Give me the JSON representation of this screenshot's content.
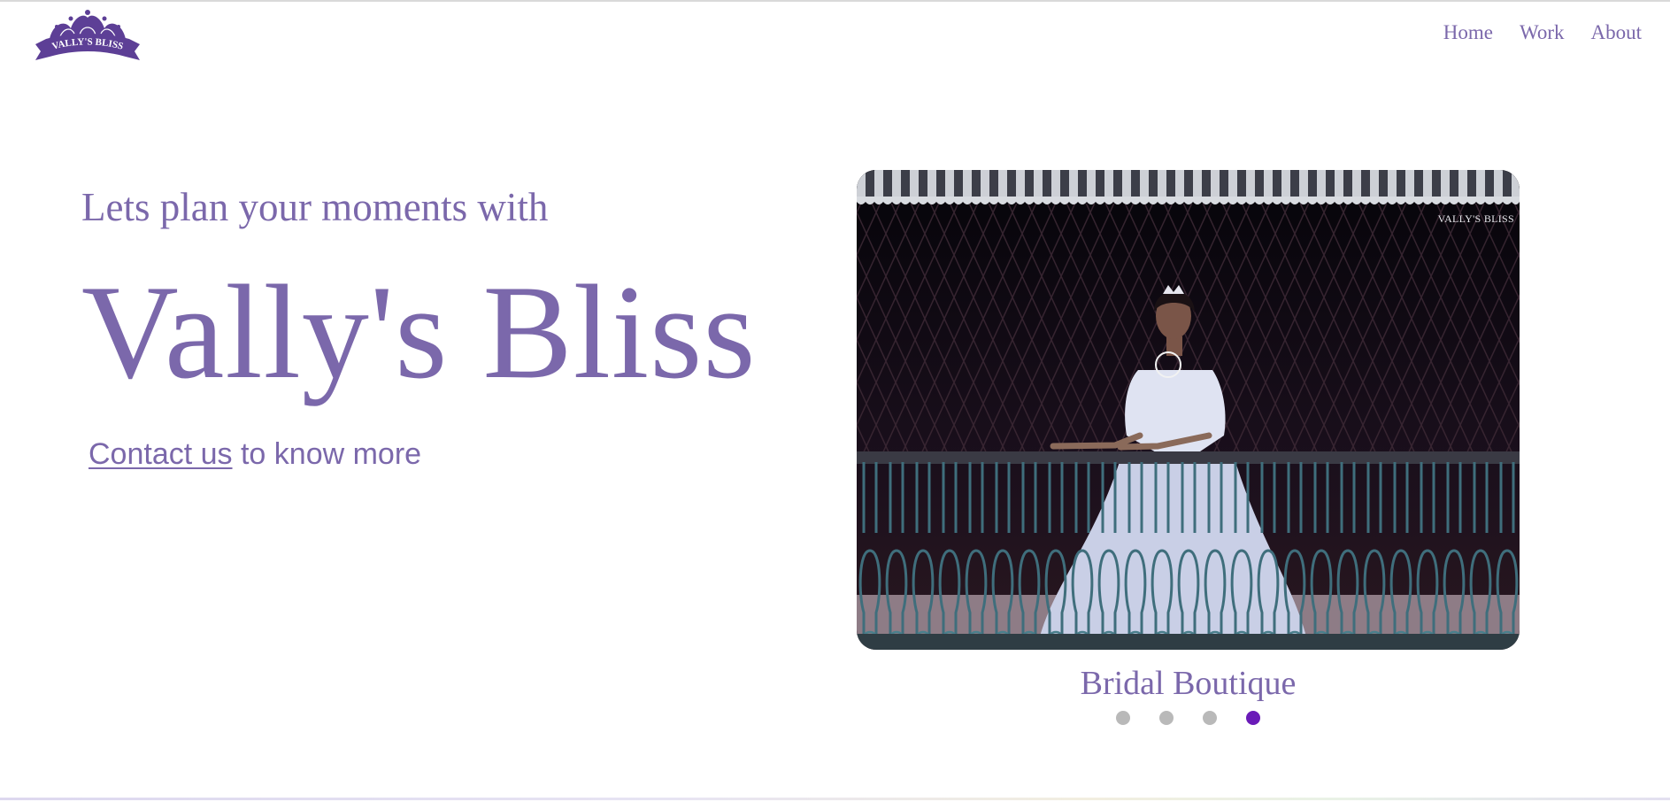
{
  "logo": {
    "text": "VALLY'S BLISS"
  },
  "nav": {
    "items": [
      {
        "label": "Home"
      },
      {
        "label": "Work"
      },
      {
        "label": "About"
      }
    ]
  },
  "hero": {
    "tagline": "Lets plan your moments with",
    "brand": "Vally's Bliss",
    "cta_link": "Contact us",
    "cta_rest": " to know more"
  },
  "slider": {
    "watermark": "VALLY'S BLISS",
    "caption": "Bridal Boutique",
    "total_slides": 4,
    "active_index": 4
  },
  "colors": {
    "brand_purple": "#7b68ab",
    "active_dot": "#6a1bb8",
    "inactive_dot": "#b9b9b9"
  }
}
